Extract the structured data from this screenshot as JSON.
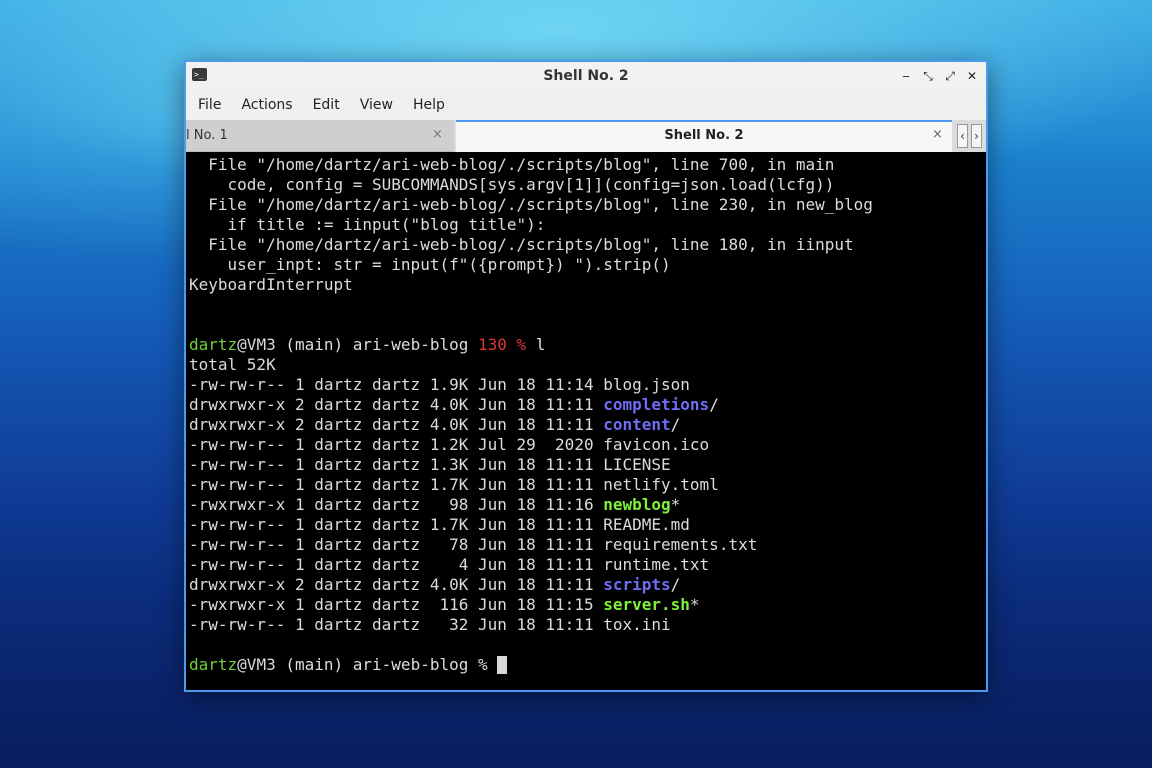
{
  "window": {
    "title": "Shell No. 2",
    "controls": {
      "minimize": "‒",
      "restore": "⤡",
      "maximize": "⤢",
      "close": "✕"
    }
  },
  "menu": [
    "File",
    "Actions",
    "Edit",
    "View",
    "Help"
  ],
  "tabs": [
    {
      "label": "l No. 1",
      "close": "×",
      "active": false
    },
    {
      "label": "Shell No. 2",
      "close": "×",
      "active": true
    }
  ],
  "tab_scroll": {
    "left": "‹",
    "right": "›"
  },
  "terminal": {
    "traceback": [
      "  File \"/home/dartz/ari-web-blog/./scripts/blog\", line 700, in main",
      "    code, config = SUBCOMMANDS[sys.argv[1]](config=json.load(lcfg))",
      "  File \"/home/dartz/ari-web-blog/./scripts/blog\", line 230, in new_blog",
      "    if title := iinput(\"blog title\"):",
      "  File \"/home/dartz/ari-web-blog/./scripts/blog\", line 180, in iinput",
      "    user_inpt: str = input(f\"({prompt}) \").strip()",
      "KeyboardInterrupt"
    ],
    "prompt1": {
      "user": "dartz",
      "rest": "@VM3 (main) ari-web-blog ",
      "status": "130 %",
      "command": " l"
    },
    "total": "total 52K",
    "listing": [
      {
        "meta": "-rw-rw-r-- 1 dartz dartz 1.9K Jun 18 11:14 ",
        "name": "blog.json",
        "kind": "file",
        "suffix": ""
      },
      {
        "meta": "drwxrwxr-x 2 dartz dartz 4.0K Jun 18 11:11 ",
        "name": "completions",
        "kind": "dir",
        "suffix": "/"
      },
      {
        "meta": "drwxrwxr-x 2 dartz dartz 4.0K Jun 18 11:11 ",
        "name": "content",
        "kind": "dir",
        "suffix": "/"
      },
      {
        "meta": "-rw-rw-r-- 1 dartz dartz 1.2K Jul 29  2020 ",
        "name": "favicon.ico",
        "kind": "file",
        "suffix": ""
      },
      {
        "meta": "-rw-rw-r-- 1 dartz dartz 1.3K Jun 18 11:11 ",
        "name": "LICENSE",
        "kind": "file",
        "suffix": ""
      },
      {
        "meta": "-rw-rw-r-- 1 dartz dartz 1.7K Jun 18 11:11 ",
        "name": "netlify.toml",
        "kind": "file",
        "suffix": ""
      },
      {
        "meta": "-rwxrwxr-x 1 dartz dartz   98 Jun 18 11:16 ",
        "name": "newblog",
        "kind": "exe",
        "suffix": "*"
      },
      {
        "meta": "-rw-rw-r-- 1 dartz dartz 1.7K Jun 18 11:11 ",
        "name": "README.md",
        "kind": "file",
        "suffix": ""
      },
      {
        "meta": "-rw-rw-r-- 1 dartz dartz   78 Jun 18 11:11 ",
        "name": "requirements.txt",
        "kind": "file",
        "suffix": ""
      },
      {
        "meta": "-rw-rw-r-- 1 dartz dartz    4 Jun 18 11:11 ",
        "name": "runtime.txt",
        "kind": "file",
        "suffix": ""
      },
      {
        "meta": "drwxrwxr-x 2 dartz dartz 4.0K Jun 18 11:11 ",
        "name": "scripts",
        "kind": "dir",
        "suffix": "/"
      },
      {
        "meta": "-rwxrwxr-x 1 dartz dartz  116 Jun 18 11:15 ",
        "name": "server.sh",
        "kind": "exe",
        "suffix": "*"
      },
      {
        "meta": "-rw-rw-r-- 1 dartz dartz   32 Jun 18 11:11 ",
        "name": "tox.ini",
        "kind": "file",
        "suffix": ""
      }
    ],
    "prompt2": {
      "user": "dartz",
      "rest": "@VM3 (main) ari-web-blog % "
    }
  },
  "colors": {
    "prompt_user": "#6fcf3a",
    "status": "#e0353a",
    "dir": "#6f6cf5",
    "exe": "#7ef03a",
    "accent": "#4a9bf0"
  }
}
